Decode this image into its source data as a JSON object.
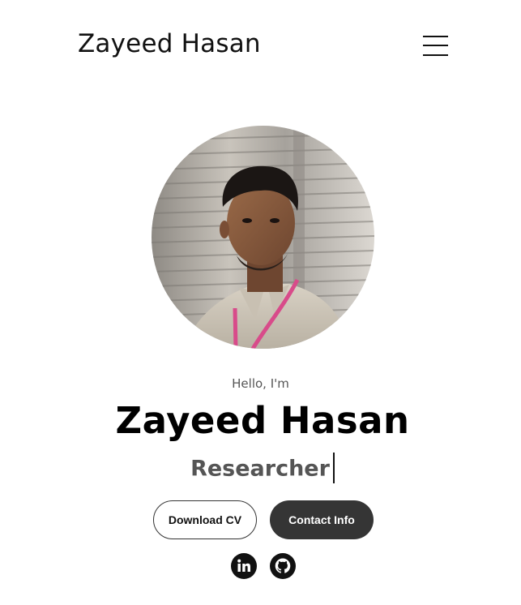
{
  "header": {
    "logo_text": "Zayeed Hasan",
    "menu_icon": "hamburger-menu-icon"
  },
  "hero": {
    "greeting": "Hello, I'm",
    "name": "Zayeed Hasan",
    "role": "Researcher"
  },
  "buttons": {
    "download_cv": "Download CV",
    "contact_info": "Contact Info"
  },
  "social": {
    "linkedin_icon": "linkedin-icon",
    "github_icon": "github-icon"
  },
  "colors": {
    "dark_button": "#353535",
    "greeting_text": "#555555",
    "role_text": "#555555"
  }
}
